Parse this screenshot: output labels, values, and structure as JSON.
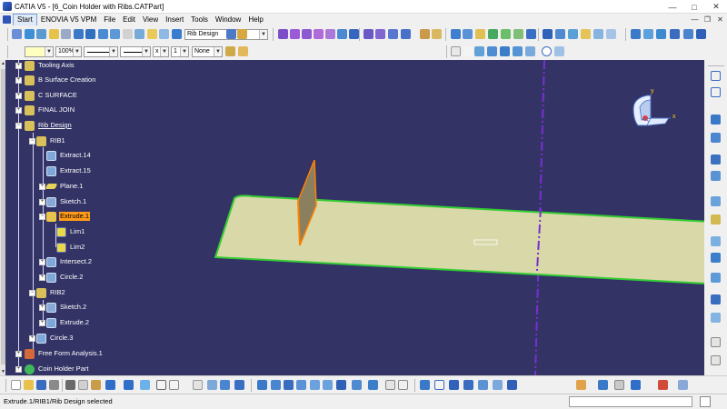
{
  "window": {
    "title": "CATIA V5 - [6_Coin Holder with Ribs.CATPart]"
  },
  "menubar": {
    "items": [
      "Start",
      "ENOVIA V5 VPM",
      "File",
      "Edit",
      "View",
      "Insert",
      "Tools",
      "Window",
      "Help"
    ]
  },
  "toolbar": {
    "workbench_combo": "Rib Design",
    "fill_combo": "",
    "zoom_combo": "100%",
    "line_type_combo": "",
    "thickness_combo": "",
    "point_combo": "x",
    "layer_num_combo": "1",
    "layer_combo": "None"
  },
  "tree": {
    "items": [
      {
        "label": "Tooling Axis"
      },
      {
        "label": "B Surface Creation"
      },
      {
        "label": "C SURFACE"
      },
      {
        "label": "FINAL JOIN"
      },
      {
        "label": "Rib Design"
      },
      {
        "label": "RIB1"
      },
      {
        "label": "Extract.14"
      },
      {
        "label": "Extract.15"
      },
      {
        "label": "Plane.1"
      },
      {
        "label": "Sketch.1"
      },
      {
        "label": "Extrude.1"
      },
      {
        "label": "Lim1"
      },
      {
        "label": "Lim2"
      },
      {
        "label": "Intersect.2"
      },
      {
        "label": "Circle.2"
      },
      {
        "label": "RIB2"
      },
      {
        "label": "Sketch.2"
      },
      {
        "label": "Extrude.2"
      },
      {
        "label": "Circle.3"
      },
      {
        "label": "Free Form Analysis.1"
      },
      {
        "label": "Coin Holder Part"
      }
    ]
  },
  "compass": {
    "x_label": "x",
    "y_label": "y"
  },
  "status": {
    "text": "Extrude.1/RIB1/Rib Design selected",
    "command_input": ""
  },
  "colors": {
    "viewport_bg": "#333366",
    "surface_fill": "#d8d8a8",
    "surface_edge": "#33cc33",
    "rib_fill": "#8a8060",
    "rib_edge": "#ff8000",
    "axis_line": "#7a2fd0",
    "selection_highlight": "#ff9a1a"
  }
}
